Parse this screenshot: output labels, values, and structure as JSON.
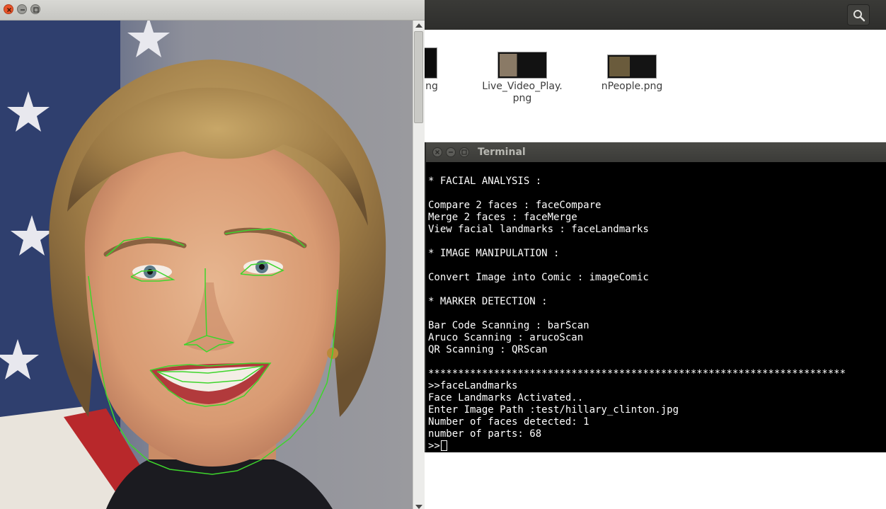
{
  "file_manager": {
    "search_icon": "search-icon",
    "files": [
      {
        "name": "ng"
      },
      {
        "name": "Live_Video_Play.\npng"
      },
      {
        "name": "nPeople.png"
      }
    ]
  },
  "viewer": {
    "window_controls": [
      "close-icon",
      "minimize-icon",
      "maximize-icon"
    ],
    "image_subject": "portrait with facial landmarks overlay",
    "landmark_color": "#3ed52c"
  },
  "terminal": {
    "title": "Terminal",
    "lines": [
      "* FACIAL ANALYSIS :",
      "",
      "Compare 2 faces : faceCompare",
      "Merge 2 faces : faceMerge",
      "View facial landmarks : faceLandmarks",
      "",
      "* IMAGE MANIPULATION :",
      "",
      "Convert Image into Comic : imageComic",
      "",
      "* MARKER DETECTION :",
      "",
      "Bar Code Scanning : barScan",
      "Aruco Scanning : arucoScan",
      "QR Scanning : QRScan",
      "",
      "**********************************************************************",
      ">>faceLandmarks",
      "Face Landmarks Activated..",
      "Enter Image Path :test/hillary_clinton.jpg",
      "Number of faces detected: 1",
      "number of parts: 68"
    ],
    "prompt": ">>"
  }
}
